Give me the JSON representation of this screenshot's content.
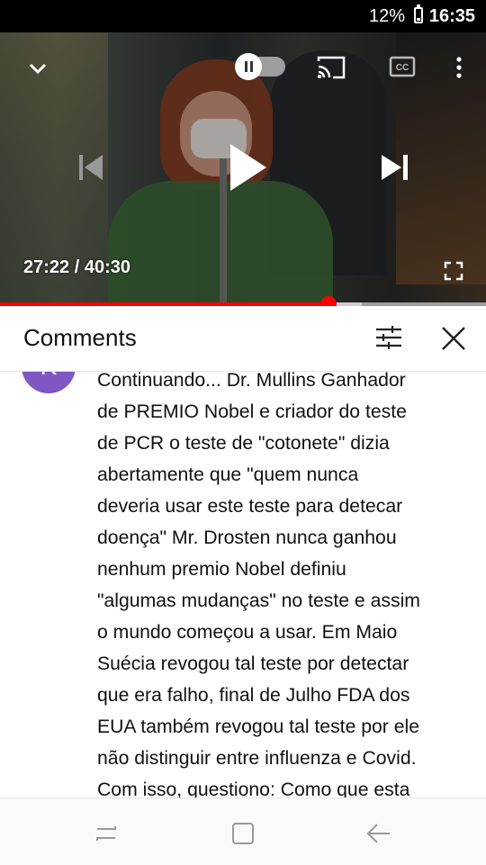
{
  "status_bar": {
    "battery": "12%",
    "time": "16:35"
  },
  "player": {
    "current_time": "27:22",
    "duration": "40:30",
    "time_separator": " / ",
    "progress_fraction": 0.675,
    "buffer_fraction": 0.745,
    "progress_color": "#ff0000"
  },
  "comments_panel": {
    "title": "Comments",
    "comment": {
      "avatar_letter": "K",
      "avatar_color": "#7e57c2",
      "text": "Continuando... Dr. Mullins Ganhador\nde PREMIO Nobel e criador do teste\nde PCR o teste de \"cotonete\" dizia\nabertamente que \"quem nunca\ndeveria usar este teste para detecar\ndoença\" Mr. Drosten nunca ganhou\nnenhum premio Nobel definiu\n\"algumas mudanças\" no teste e assim\no mundo começou a usar. Em Maio\nSuécia revogou tal teste por detectar\nque era falho, final de Julho FDA dos\nEUA também revogou tal teste por ele\nnão distinguir entre influenza e Covid.\nCom isso, questiono: Como que esta"
    }
  },
  "icons": {
    "minimize": "chevron-down-icon",
    "autoplay": "autoplay-toggle",
    "cast": "cast-icon",
    "captions": "cc-icon",
    "more": "more-icon",
    "previous": "previous-icon",
    "play": "play-icon",
    "next": "next-icon",
    "fullscreen": "fullscreen-icon",
    "sort": "sort-icon",
    "close": "close-icon",
    "recents": "recents-icon",
    "home": "home-icon",
    "back": "back-icon"
  }
}
